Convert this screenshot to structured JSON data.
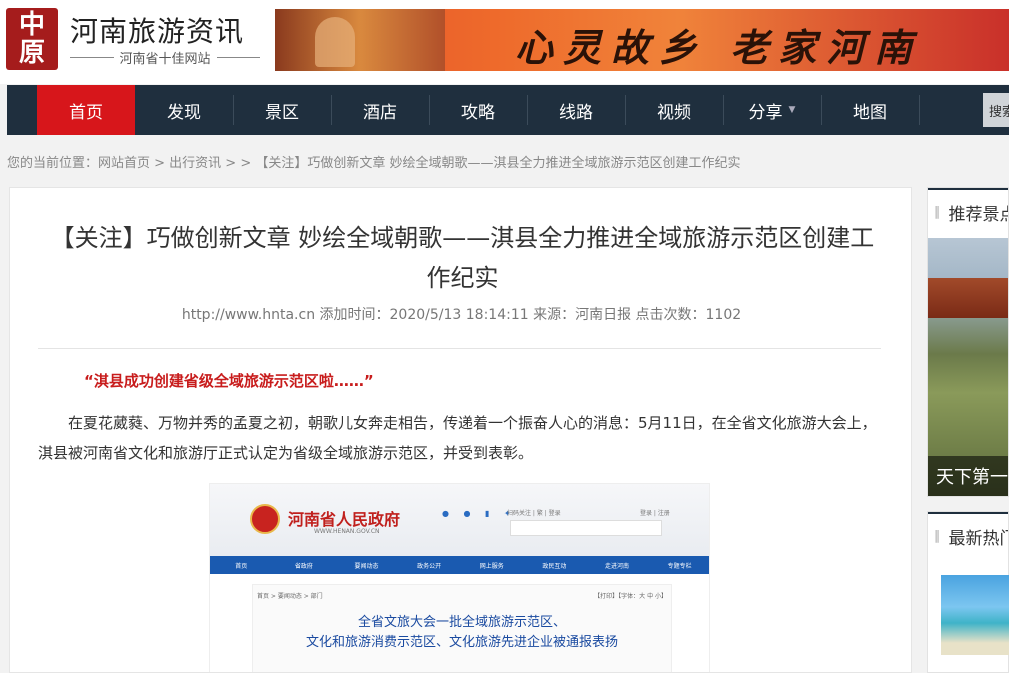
{
  "header": {
    "logo_chars": [
      "中",
      "原"
    ],
    "site_title": "河南旅游资讯",
    "site_subtitle": "河南省十佳网站",
    "banner_text": "心灵故乡  老家河南"
  },
  "nav": {
    "items": [
      "首页",
      "发现",
      "景区",
      "酒店",
      "攻略",
      "线路",
      "视频",
      "分享",
      "地图"
    ],
    "active_index": 0,
    "share_caret": "▼",
    "search_label": "搜索"
  },
  "breadcrumb": "您的当前位置：网站首页 > 出行资讯 > > 【关注】巧做创新文章 妙绘全域朝歌——淇县全力推进全域旅游示范区创建工作纪实",
  "article": {
    "title": "【关注】巧做创新文章 妙绘全域朝歌——淇县全力推进全域旅游示范区创建工作纪实",
    "meta": "http://www.hnta.cn 添加时间：2020/5/13 18:14:11 来源：河南日报 点击次数：1102",
    "quote": "“淇县成功创建省级全域旅游示范区啦……”",
    "paragraph": "在夏花葳蕤、万物并秀的孟夏之初，朝歌儿女奔走相告，传递着一个振奋人心的消息：5月11日，在全省文化旅游大会上，淇县被河南省文化和旅游厅正式认定为省级全域旅游示范区，并受到表彰。",
    "screenshot": {
      "gov_title": "河南省人民政府",
      "gov_url": "WWW.HENAN.GOV.CN",
      "top_links": "扫码关注 | 繁 | 登录",
      "top_links_right": "登录 | 注册",
      "nav": [
        "首页",
        "省政府",
        "要闻动态",
        "政务公开",
        "网上服务",
        "政民互动",
        "走进河南",
        "专题专栏"
      ],
      "crumb": "首页 > 要闻动态 > 部门",
      "tools": "【打印】【字体：大 中 小】",
      "headline_line1": "全省文旅大会一批全域旅游示范区、",
      "headline_line2": "文化和旅游消费示范区、文化旅游先进企业被通报表扬"
    }
  },
  "sidebar": {
    "recommend_title": "推荐景点",
    "recommend_caption": "天下第一",
    "latest_title": "最新热门",
    "head_marker": "∥"
  }
}
